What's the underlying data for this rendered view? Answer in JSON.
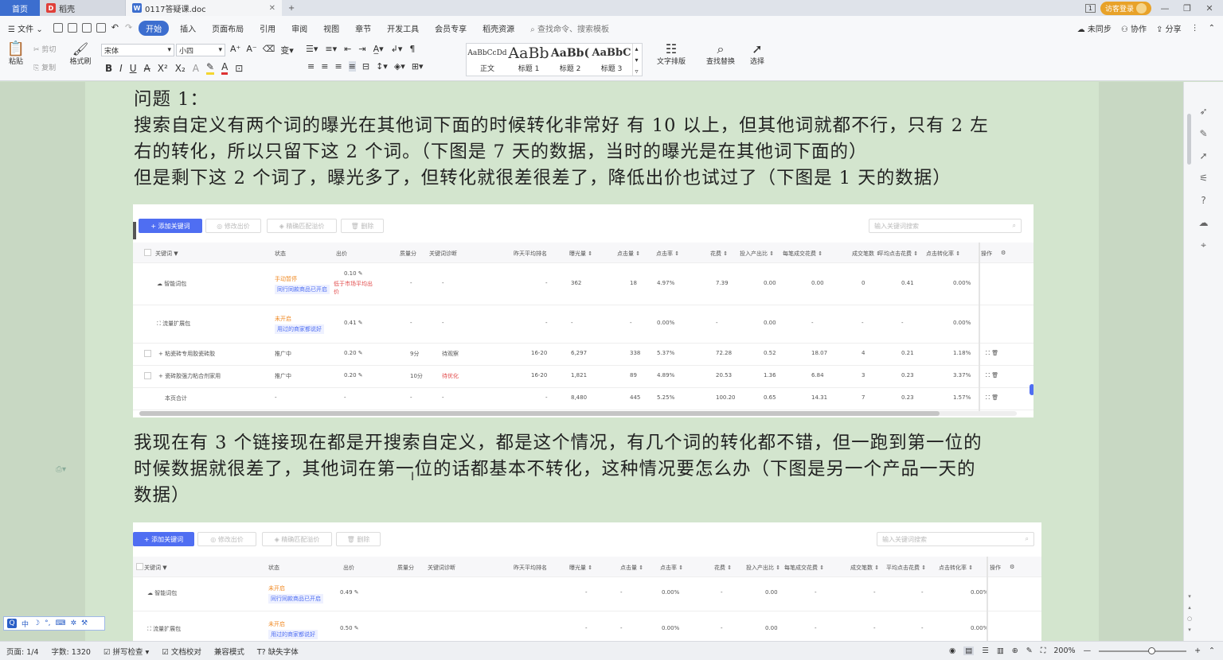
{
  "tabs": {
    "home": "首页",
    "docer": "稻壳",
    "doc": "0117答疑课.doc"
  },
  "titlebar": {
    "login": "访客登录",
    "ratio_icon": "1"
  },
  "menu": {
    "file": "文件",
    "items": [
      "开始",
      "插入",
      "页面布局",
      "引用",
      "审阅",
      "视图",
      "章节",
      "开发工具",
      "会员专享",
      "稻壳资源"
    ],
    "search": "查找命令、搜索模板",
    "sync": "未同步",
    "collab": "协作",
    "share": "分享"
  },
  "ribbon": {
    "paste": "粘贴",
    "cut": "剪切",
    "copy": "复制",
    "format_painter": "格式刷",
    "font_name": "宋体",
    "font_size": "小四",
    "styles": [
      {
        "sample": "AaBbCcDd",
        "label": "正文"
      },
      {
        "sample": "AaBb",
        "label": "标题 1"
      },
      {
        "sample": "AaBb(",
        "label": "标题 2"
      },
      {
        "sample": "AaBbC",
        "label": "标题 3"
      }
    ],
    "text_layout": "文字排版",
    "find_replace": "查找替换",
    "select": "选择"
  },
  "doc": {
    "p1_title": "问题 1：",
    "p1_l1": "搜索自定义有两个词的曝光在其他词下面的时候转化非常好  有 10 以上，但其他词就都不行，只有 2 左",
    "p1_l2": "右的转化，所以只留下这 2 个词。（下图是 7 天的数据，当时的曝光是在其他词下面的）",
    "p1_l3": "但是剩下这 2 个词了，曝光多了，但转化就很差很差了，降低出价也试过了（下图是 1 天的数据）",
    "p2_l1": "我现在有 3 个链接现在都是开搜索自定义，都是这个情况，有几个词的转化都不错，但一跑到第一位的",
    "p2_l2": "时候数据就很差了，其他词在第一位的话都基本不转化，这种情况要怎么办（下图是另一个产品一天的",
    "p2_l3": "数据）"
  },
  "shot": {
    "buttons": [
      "+ 添加关键词",
      "◎ 修改出价",
      "◈ 精确匹配溢价",
      "🗑 删除"
    ],
    "search_placeholder": "输入关键词搜索",
    "headers": [
      "关键词 ▼",
      "状态",
      "出价",
      "质量分",
      "关键词诊断",
      "昨天平均排名",
      "曝光量 ⇕",
      "点击量 ⇕",
      "点击率 ⇕",
      "花费 ⇕",
      "投入产出比 ⇕",
      "每笔成交花费 ⇕",
      "成交笔数 ⇕",
      "平均点击花费 ⇕",
      "点击转化率 ⇕",
      "操作",
      "⚙"
    ],
    "rows1": [
      {
        "kw": "☁ 智能词包",
        "status": "手动暂停",
        "status_cls": "orange",
        "status_sub": "同行同款商品已开启",
        "bid": "0.10 ✎",
        "bid_sub": "低于市场平均出价",
        "q": "-",
        "diag": "-",
        "rank": "-",
        "imp": "362",
        "clk": "18",
        "ctr": "4.97%",
        "cost": "7.39",
        "roi": "0.00",
        "cpo": "0.00",
        "orders": "0",
        "cpc": "0.41",
        "cvr": "0.00%"
      },
      {
        "kw": "⛶ 流量扩展包",
        "status": "未开启",
        "status_cls": "orange",
        "status_sub": "用过的商家都说好",
        "bid": "0.41 ✎",
        "bid_sub": "",
        "q": "-",
        "diag": "-",
        "rank": "-",
        "imp": "-",
        "clk": "-",
        "ctr": "0.00%",
        "cost": "-",
        "roi": "0.00",
        "cpo": "-",
        "orders": "-",
        "cpc": "-",
        "cvr": "0.00%"
      },
      {
        "kw": "+ 粘瓷砖专用胶瓷砖胶",
        "status": "推广中",
        "status_cls": "",
        "status_sub": "",
        "bid": "0.20 ✎",
        "bid_sub": "",
        "q": "9分",
        "diag": "待观察",
        "rank": "16-20",
        "imp": "6,297",
        "clk": "338",
        "ctr": "5.37%",
        "cost": "72.28",
        "roi": "0.52",
        "cpo": "18.07",
        "orders": "4",
        "cpc": "0.21",
        "cvr": "1.18%"
      },
      {
        "kw": "+ 瓷砖胶强力粘合剂家用",
        "status": "推广中",
        "status_cls": "",
        "status_sub": "",
        "bid": "0.20 ✎",
        "bid_sub": "",
        "q": "10分",
        "diag": "待优化",
        "rank": "16-20",
        "imp": "1,821",
        "clk": "89",
        "ctr": "4.89%",
        "cost": "20.53",
        "roi": "1.36",
        "cpo": "6.84",
        "orders": "3",
        "cpc": "0.23",
        "cvr": "3.37%"
      },
      {
        "kw": "本页合计",
        "status": "-",
        "status_cls": "",
        "status_sub": "",
        "bid": "-",
        "bid_sub": "",
        "q": "-",
        "diag": "-",
        "rank": "-",
        "imp": "8,480",
        "clk": "445",
        "ctr": "5.25%",
        "cost": "100.20",
        "roi": "0.65",
        "cpo": "14.31",
        "orders": "7",
        "cpc": "0.23",
        "cvr": "1.57%"
      }
    ],
    "rows2": [
      {
        "kw": "☁ 智能词包",
        "status": "未开启",
        "status_sub": "同行同款商品已开启",
        "bid": "0.49 ✎",
        "imp": "-",
        "clk": "-",
        "ctr": "0.00%",
        "cost": "-",
        "roi": "0.00",
        "cpo": "-",
        "orders": "-",
        "cpc": "-",
        "cvr": "0.00%"
      },
      {
        "kw": "⛶ 流量扩展包",
        "status": "未开启",
        "status_sub": "用过的商家都说好",
        "bid": "0.50 ✎",
        "imp": "-",
        "clk": "-",
        "ctr": "0.00%",
        "cost": "-",
        "roi": "0.00",
        "cpo": "-",
        "orders": "-",
        "cpc": "-",
        "cvr": "0.00%"
      }
    ]
  },
  "status": {
    "page": "页面: 1/4",
    "words": "字数: 1320",
    "spell": "拼写检查",
    "proof": "文档校对",
    "compat": "兼容模式",
    "missing_font": "缺失字体",
    "zoom": "200%"
  },
  "ime": {
    "label": "中"
  }
}
